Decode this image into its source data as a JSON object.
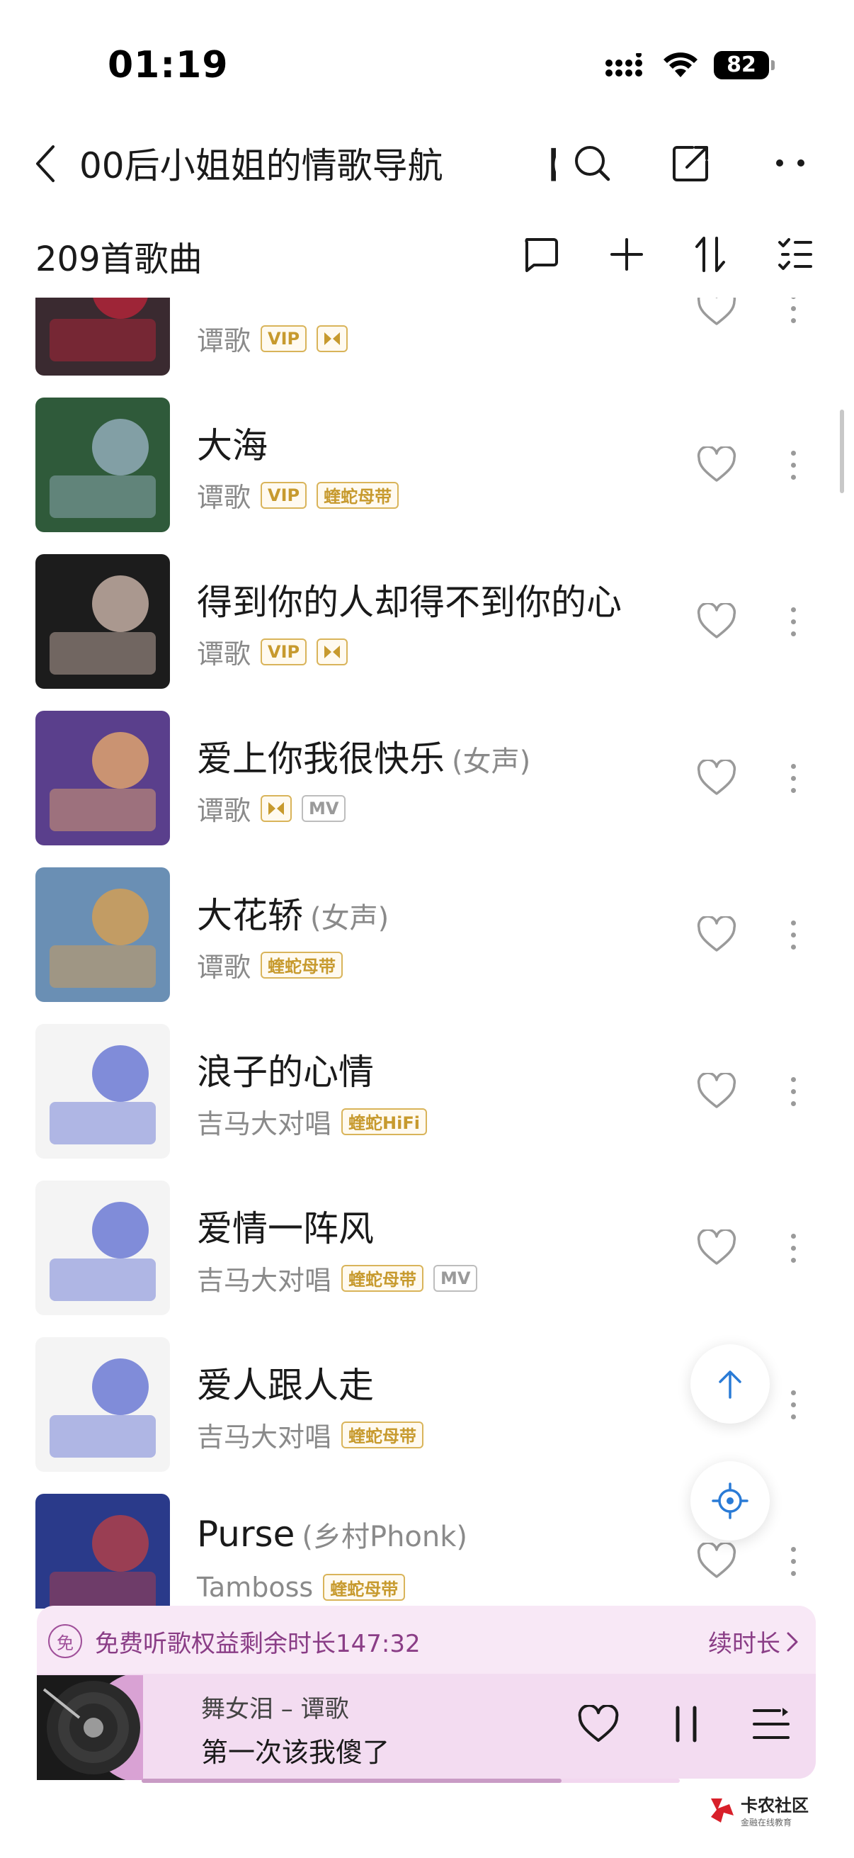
{
  "status_bar": {
    "time": "01:19",
    "battery": "82"
  },
  "header": {
    "title": "00后小姐姐的情歌导航",
    "title_cut": "【",
    "back_icon": "chevron-left-icon",
    "search_icon": "search-icon",
    "share_icon": "share-icon",
    "more_icon": "more-horizontal-icon"
  },
  "toolbar": {
    "count": "209首歌曲",
    "icons": [
      "comment-icon",
      "add-icon",
      "sort-icon",
      "multi-select-icon"
    ]
  },
  "songs": [
    {
      "title": "",
      "subtitle": "",
      "artist": "谭歌",
      "tags": [
        "VIP",
        "bow"
      ],
      "cover": "#3a2a30",
      "accent": "#c0243a"
    },
    {
      "title": "大海",
      "subtitle": "",
      "artist": "谭歌",
      "tags": [
        "VIP",
        "蝰蛇母带"
      ],
      "cover": "#2f5a3a",
      "accent": "#9fb7c9"
    },
    {
      "title": "得到你的人却得不到你的心",
      "subtitle": "",
      "artist": "谭歌",
      "tags": [
        "VIP",
        "bow"
      ],
      "cover": "#1c1c1c",
      "accent": "#d9c2b5"
    },
    {
      "title": "爱上你我很快乐",
      "subtitle": "(女声)",
      "artist": "谭歌",
      "tags": [
        "bow",
        "MV"
      ],
      "cover": "#5a3f8c",
      "accent": "#f0b06a"
    },
    {
      "title": "大花轿",
      "subtitle": "(女声)",
      "artist": "谭歌",
      "tags": [
        "蝰蛇母带"
      ],
      "cover": "#6a8fb4",
      "accent": "#e0a04a"
    },
    {
      "title": "浪子的心情",
      "subtitle": "",
      "artist": "吉马大对唱",
      "tags": [
        "蝰蛇HiFi"
      ],
      "cover": "#f4f4f4",
      "accent": "#5a6ad0"
    },
    {
      "title": "爱情一阵风",
      "subtitle": "",
      "artist": "吉马大对唱",
      "tags": [
        "蝰蛇母带",
        "MV"
      ],
      "cover": "#f4f4f4",
      "accent": "#5a6ad0"
    },
    {
      "title": "爱人跟人走",
      "subtitle": "",
      "artist": "吉马大对唱",
      "tags": [
        "蝰蛇母带"
      ],
      "cover": "#f4f4f4",
      "accent": "#5a6ad0"
    },
    {
      "title": "Purse",
      "subtitle": "(乡村Phonk)",
      "artist": "Tamboss",
      "tags": [
        "蝰蛇母带"
      ],
      "cover": "#2a3a8a",
      "accent": "#c04040"
    }
  ],
  "banner": {
    "icon_text": "免",
    "text": "免费听歌权益剩余时长147:32",
    "link": "续时长"
  },
  "player": {
    "song": "舞女泪 – 谭歌",
    "lyric": "第一次该我傻了",
    "progress": 0.78
  },
  "watermark": {
    "title": "卡农社区",
    "sub": "金融在线教育"
  },
  "colors": {
    "tag_gold": "#c79a2e",
    "banner_bg": "#f8e8f6",
    "player_bg": "#f3dcf1",
    "accent_blue": "#2a7bd6"
  }
}
